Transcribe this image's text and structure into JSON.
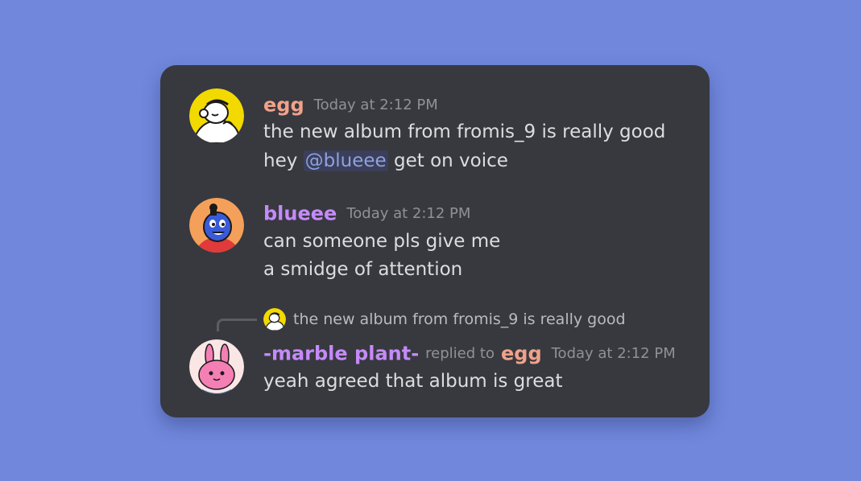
{
  "colors": {
    "background": "#7087dc",
    "card": "#37393f",
    "message_text": "#dcddde",
    "timestamp": "#8e9297",
    "mention": "#8ea1e1"
  },
  "messages": [
    {
      "username": "egg",
      "username_color": "#f0a28a",
      "timestamp": "Today at 2:12 PM",
      "avatar_icon": "egg-avatar-icon",
      "lines": {
        "first": "the new album from fromis_9 is really good",
        "second_prefix": "hey",
        "mention": "@blueee",
        "second_suffix": "get on voice"
      }
    },
    {
      "username": "blueee",
      "username_color": "#c58af9",
      "timestamp": "Today at 2:12 PM",
      "avatar_icon": "blueee-avatar-icon",
      "lines": {
        "first": "can someone pls give me",
        "second": "a smidge of attention"
      }
    },
    {
      "username": "-marble plant-",
      "username_color": "#c58af9",
      "replied_to_label": "replied to",
      "replied_to_user": "egg",
      "replied_to_user_color": "#f0a28a",
      "timestamp": "Today at 2:12 PM",
      "avatar_icon": "marble-plant-avatar-icon",
      "reply_preview": {
        "avatar_icon": "egg-avatar-small-icon",
        "text": "the new album from fromis_9 is really good"
      },
      "lines": {
        "first": "yeah agreed that album is great"
      }
    }
  ]
}
